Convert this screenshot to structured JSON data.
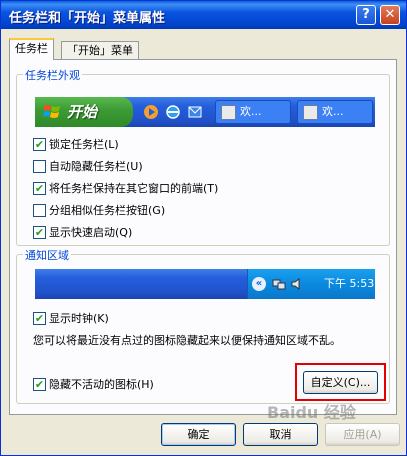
{
  "window": {
    "title": "任务栏和「开始」菜单属性",
    "help_button": "?",
    "close_button": "✕"
  },
  "tabs": [
    {
      "label": "任务栏",
      "active": true
    },
    {
      "label": "「开始」菜单",
      "active": false
    }
  ],
  "appearance": {
    "title": "任务栏外观",
    "preview": {
      "start_label": "开始",
      "task_buttons": [
        "欢...",
        "欢..."
      ]
    },
    "options": [
      {
        "label": "锁定任务栏(L)",
        "checked": true
      },
      {
        "label": "自动隐藏任务栏(U)",
        "checked": false
      },
      {
        "label": "将任务栏保持在其它窗口的前端(T)",
        "checked": true
      },
      {
        "label": "分组相似任务栏按钮(G)",
        "checked": false
      },
      {
        "label": "显示快速启动(Q)",
        "checked": true
      }
    ]
  },
  "notification": {
    "title": "通知区域",
    "preview": {
      "expand_arrow": "«",
      "time": "下午 5:53"
    },
    "show_clock": {
      "label": "显示时钟(K)",
      "checked": true
    },
    "description": "您可以将最近没有点过的图标隐藏起来以便保持通知区域不乱。",
    "hide_inactive": {
      "label": "隐藏不活动的图标(H)",
      "checked": true
    },
    "customize_button": "自定义(C)..."
  },
  "footer": {
    "ok": "确定",
    "cancel": "取消",
    "apply": "应用(A)"
  },
  "watermark": "Baidu 经验",
  "colors": {
    "title_bar": "#0a54e0",
    "group_title": "#0046d5",
    "highlight": "#e30000",
    "start_button": "#3c9a34"
  }
}
